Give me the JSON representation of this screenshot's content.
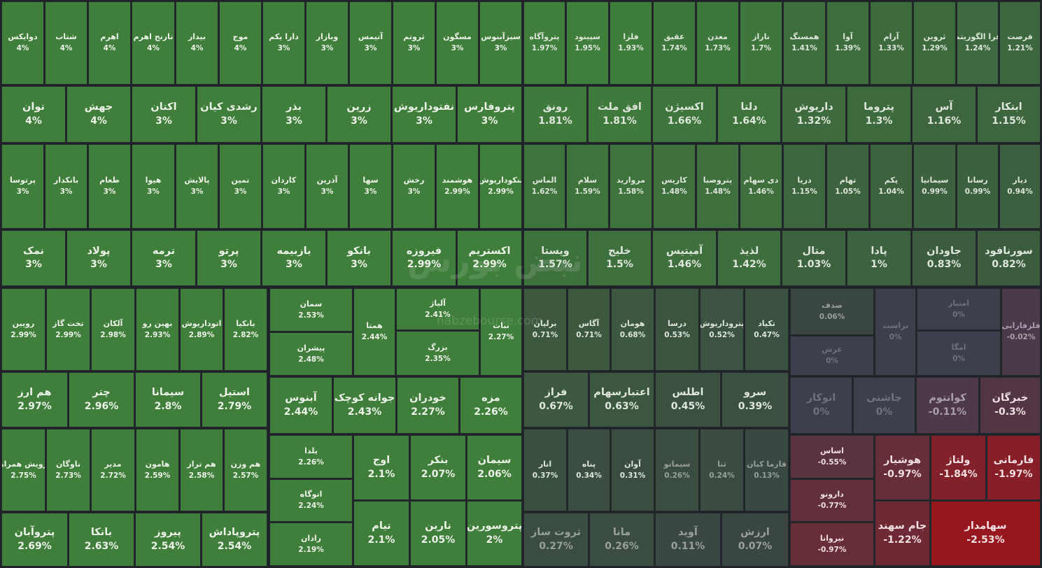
{
  "watermark": {
    "logo": "نبض بورس",
    "site": "nabzebourse.com"
  },
  "cells": [
    [
      "دوایکس",
      "4%"
    ],
    [
      "شتاب",
      "4%"
    ],
    [
      "اهرم",
      "4%"
    ],
    [
      "نارنج اهرم",
      "4%"
    ],
    [
      "بیدار",
      "4%"
    ],
    [
      "موج",
      "4%"
    ],
    [
      "دارا یکم",
      "3%"
    ],
    [
      "وبازار",
      "3%"
    ],
    [
      "آتیمس",
      "3%"
    ],
    [
      "ثروتم",
      "3%"
    ],
    [
      "مسگون",
      "3%"
    ],
    [
      "سیزآبنوس",
      "3%"
    ],
    [
      "پتروآگاه",
      "1.97%"
    ],
    [
      "سپینود",
      "1.95%"
    ],
    [
      "فلزا",
      "1.93%"
    ],
    [
      "عقیق",
      "1.74%"
    ],
    [
      "معدن",
      "1.73%"
    ],
    [
      "ناراز",
      "1.7%"
    ],
    [
      "همسنگ",
      "1.41%"
    ],
    [
      "آوا",
      "1.39%"
    ],
    [
      "آرام",
      "1.33%"
    ],
    [
      "ثروین",
      "1.29%"
    ],
    [
      "فرا الگوریتم",
      "1.24%"
    ],
    [
      "فرصت",
      "1.21%"
    ],
    [
      "توان",
      "4%"
    ],
    [
      "جهش",
      "4%"
    ],
    [
      "اکتان",
      "3%"
    ],
    [
      "رشدی کیان",
      "3%"
    ],
    [
      "بذر",
      "3%"
    ],
    [
      "زرین",
      "3%"
    ],
    [
      "نفتوداریوش",
      "3%"
    ],
    [
      "پتروفارس",
      "3%"
    ],
    [
      "رونق",
      "1.81%"
    ],
    [
      "افق ملت",
      "1.81%"
    ],
    [
      "اکسیژن",
      "1.66%"
    ],
    [
      "دلتا",
      "1.64%"
    ],
    [
      "داریوش",
      "1.32%"
    ],
    [
      "پتروما",
      "1.3%"
    ],
    [
      "آس",
      "1.16%"
    ],
    [
      "ابتکار",
      "1.15%"
    ],
    [
      "پرتوسا",
      "3%"
    ],
    [
      "بانکدار",
      "3%"
    ],
    [
      "طعام",
      "3%"
    ],
    [
      "هیوا",
      "3%"
    ],
    [
      "پالایش",
      "3%"
    ],
    [
      "تمین",
      "3%"
    ],
    [
      "کاردان",
      "3%"
    ],
    [
      "آذرین",
      "3%"
    ],
    [
      "سها",
      "3%"
    ],
    [
      "رخش",
      "3%"
    ],
    [
      "هوشمند",
      "2.99%"
    ],
    [
      "بنکوداریوش",
      "2.99%"
    ],
    [
      "الماس",
      "1.62%"
    ],
    [
      "سلام",
      "1.59%"
    ],
    [
      "مروارید",
      "1.58%"
    ],
    [
      "کاریس",
      "1.48%"
    ],
    [
      "پتروصبا",
      "1.48%"
    ],
    [
      "دی سهام",
      "1.46%"
    ],
    [
      "دریا",
      "1.15%"
    ],
    [
      "تهام",
      "1.05%"
    ],
    [
      "یکم",
      "1.04%"
    ],
    [
      "سیمانیا",
      "0.99%"
    ],
    [
      "رسانا",
      "0.99%"
    ],
    [
      "دیار",
      "0.94%"
    ],
    [
      "نمک",
      "3%"
    ],
    [
      "پولاد",
      "3%"
    ],
    [
      "ترمه",
      "3%"
    ],
    [
      "پرتو",
      "3%"
    ],
    [
      "بازبیمه",
      "3%"
    ],
    [
      "بانکو",
      "3%"
    ],
    [
      "فیروزه",
      "2.99%"
    ],
    [
      "اکستریم",
      "2.99%"
    ],
    [
      "ویستا",
      "1.57%"
    ],
    [
      "خلیج",
      "1.5%"
    ],
    [
      "آمیتیس",
      "1.46%"
    ],
    [
      "لذیذ",
      "1.42%"
    ],
    [
      "متال",
      "1.03%"
    ],
    [
      "پادا",
      "1%"
    ],
    [
      "جاودان",
      "0.83%"
    ],
    [
      "سورنافود",
      "0.82%"
    ],
    [
      "رویین",
      "2.99%"
    ],
    [
      "تخت گاز",
      "2.99%"
    ],
    [
      "آلکان",
      "2.98%"
    ],
    [
      "بهین رو",
      "2.93%"
    ],
    [
      "اتوداریوش",
      "2.89%"
    ],
    [
      "بانکیا",
      "2.82%"
    ],
    [
      "هم ارز",
      "2.97%"
    ],
    [
      "چتر",
      "2.96%"
    ],
    [
      "سیمانا",
      "2.8%"
    ],
    [
      "استیل",
      "2.79%"
    ],
    [
      "رویش همراه",
      "2.75%"
    ],
    [
      "ناوگان",
      "2.73%"
    ],
    [
      "مدیر",
      "2.72%"
    ],
    [
      "هامون",
      "2.59%"
    ],
    [
      "هم تراز",
      "2.58%"
    ],
    [
      "هم وزن",
      "2.57%"
    ],
    [
      "پتروآبان",
      "2.69%"
    ],
    [
      "بانکا",
      "2.63%"
    ],
    [
      "پیروز",
      "2.54%"
    ],
    [
      "پتروپاداش",
      "2.54%"
    ],
    [
      "سمان",
      "2.53%"
    ],
    [
      "پیشران",
      "2.48%"
    ],
    [
      "همتا",
      "2.44%"
    ],
    [
      "آلیاژ",
      "2.41%"
    ],
    [
      "بزرگ",
      "2.35%"
    ],
    [
      "نبات",
      "2.27%"
    ],
    [
      "آبنوس",
      "2.44%"
    ],
    [
      "جوانه کوچک",
      "2.43%"
    ],
    [
      "خودران",
      "2.27%"
    ],
    [
      "مزه",
      "2.26%"
    ],
    [
      "یلدا",
      "2.26%"
    ],
    [
      "اتوگاه",
      "2.24%"
    ],
    [
      "رادان",
      "2.19%"
    ],
    [
      "اوج",
      "2.1%"
    ],
    [
      "بنکر",
      "2.07%"
    ],
    [
      "سیمان",
      "2.06%"
    ],
    [
      "تیام",
      "2.1%"
    ],
    [
      "نارین",
      "2.05%"
    ],
    [
      "پتروسورین",
      "2%"
    ],
    [
      "برلیان",
      "0.71%"
    ],
    [
      "آگاس",
      "0.71%"
    ],
    [
      "هومان",
      "0.68%"
    ],
    [
      "درسا",
      "0.53%"
    ],
    [
      "پتروداریوش",
      "0.52%"
    ],
    [
      "تکیاد",
      "0.47%"
    ],
    [
      "فراز",
      "0.67%"
    ],
    [
      "اعتبارسهام",
      "0.63%"
    ],
    [
      "اطلس",
      "0.45%"
    ],
    [
      "سرو",
      "0.39%"
    ],
    [
      "انار",
      "0.37%"
    ],
    [
      "پناه",
      "0.34%"
    ],
    [
      "آوان",
      "0.31%"
    ],
    [
      "سیمانو",
      "0.26%"
    ],
    [
      "ثنا",
      "0.24%"
    ],
    [
      "فارما کیان",
      "0.13%"
    ],
    [
      "ثروت ساز",
      "0.27%"
    ],
    [
      "مانا",
      "0.26%"
    ],
    [
      "آوید",
      "0.11%"
    ],
    [
      "ارزش",
      "0.07%"
    ],
    [
      "صدف",
      "0.06%"
    ],
    [
      "تراست",
      "0%"
    ],
    [
      "امتیاز",
      "0%"
    ],
    [
      "عرش",
      "0%"
    ],
    [
      "امگا",
      "0%"
    ],
    [
      "فلزفارابی",
      "-0.02%"
    ],
    [
      "اتوکار",
      "0%"
    ],
    [
      "چاشنی",
      "0%"
    ],
    [
      "کوانتوم",
      "-0.11%"
    ],
    [
      "خبرگان",
      "-0.3%"
    ],
    [
      "اساس",
      "-0.55%"
    ],
    [
      "هوشیار",
      "-0.97%"
    ],
    [
      "ولتاژ",
      "-1.84%"
    ],
    [
      "فارمانی",
      "-1.97%"
    ],
    [
      "دارونو",
      "-0.77%"
    ],
    [
      "جام سهند",
      "-1.22%"
    ],
    [
      "سهامدار",
      "-2.53%"
    ],
    [
      "نیروانا",
      "-0.97%"
    ]
  ]
}
